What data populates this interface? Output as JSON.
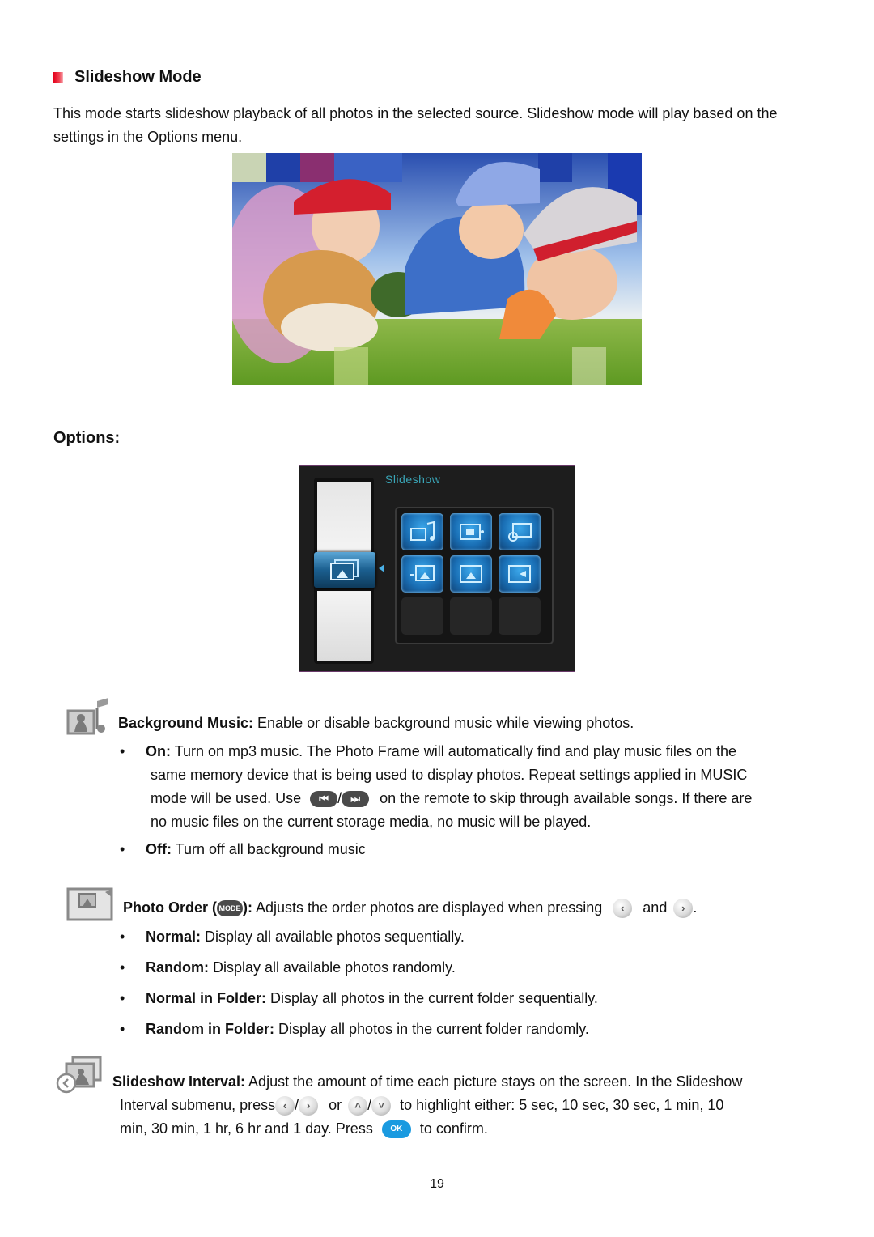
{
  "section": {
    "title": "Slideshow Mode",
    "intro": "This mode starts slideshow playback of all photos in the selected source. Slideshow mode will play based on the settings in the Options menu."
  },
  "collage": {
    "description": "Slideshow transition collage of children with a dog in a park",
    "icon": "photo-collage-image"
  },
  "options_heading": "Options:",
  "menu_screenshot": {
    "title": "Slideshow",
    "icons": [
      "background-music-icon",
      "photo-order-icon",
      "transition-icon",
      "slideshow-interval-icon",
      "display-mode-icon",
      "exit-icon"
    ]
  },
  "background_music": {
    "label": "Background Music:",
    "description": " Enable or disable background music while viewing photos.",
    "icon": "background-music-icon",
    "on": {
      "label": "On:",
      "line1": " Turn on mp3 music. The Photo Frame will automatically find and play music files on the",
      "line2": "same memory device that is being used to display photos. Repeat settings applied in MUSIC",
      "line3a": "mode will be used. Use",
      "line3b": "on the remote to skip through available songs. If there are",
      "line4": "no music files on the current storage media, no music will be played.",
      "prev_button": "⏮",
      "next_button": "⏭",
      "slash": "/"
    },
    "off": {
      "label": "Off:",
      "text": " Turn off all background music"
    }
  },
  "photo_order": {
    "label_start": "Photo Order (",
    "mode_button": "MODE",
    "label_end": "):",
    "description": " Adjusts the order photos are displayed when pressing",
    "and": "and",
    "period": ".",
    "left_button": "‹",
    "right_button": "›",
    "items": [
      {
        "label": "Normal:",
        "text": " Display all available photos sequentially."
      },
      {
        "label": "Random:",
        "text": " Display all available photos randomly."
      },
      {
        "label": "Normal in Folder:",
        "text": " Display all photos in the current folder sequentially."
      },
      {
        "label": "Random in Folder:",
        "text": " Display all photos in the current folder randomly."
      }
    ]
  },
  "slideshow_interval": {
    "label": "Slideshow Interval:",
    "line1": " Adjust the amount of time each picture stays on the screen. In the Slideshow",
    "line2a": "Interval submenu, press",
    "slash": "/",
    "or": "or",
    "line2b": "to highlight either: 5 sec, 10 sec, 30 sec, 1 min, 10",
    "line3a": "min, 30 min, 1 hr, 6 hr and 1 day. Press",
    "ok_button": "OK",
    "line3b": "to confirm.",
    "left_button": "‹",
    "right_button": "›",
    "up_button": "˄",
    "down_button": "˅"
  },
  "bullet_char": "•",
  "page_number": "19"
}
